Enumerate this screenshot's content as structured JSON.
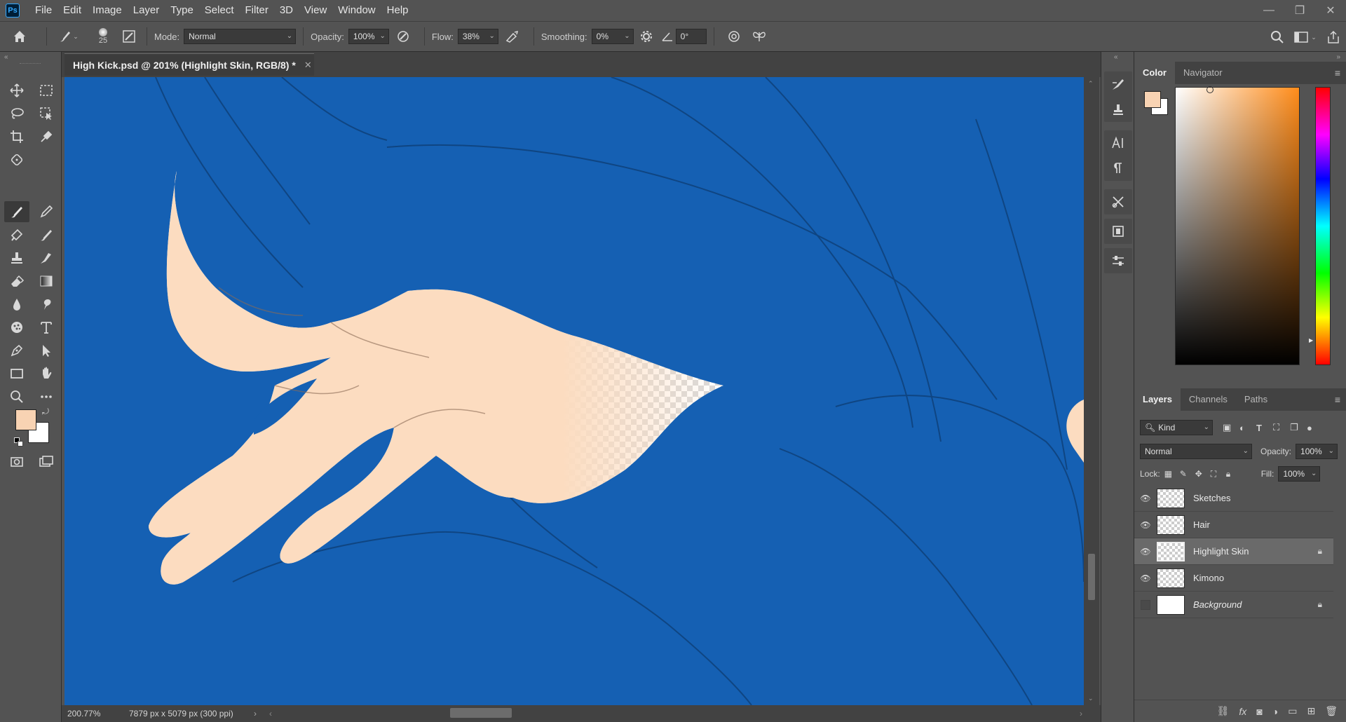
{
  "app": {
    "logo": "Ps"
  },
  "menu": [
    "File",
    "Edit",
    "Image",
    "Layer",
    "Type",
    "Select",
    "Filter",
    "3D",
    "View",
    "Window",
    "Help"
  ],
  "window_controls": {
    "minimize": "—",
    "restore": "❐",
    "close": "✕"
  },
  "options": {
    "brush_size": "25",
    "mode_label": "Mode:",
    "mode_value": "Normal",
    "opacity_label": "Opacity:",
    "opacity_value": "100%",
    "flow_label": "Flow:",
    "flow_value": "38%",
    "smoothing_label": "Smoothing:",
    "smoothing_value": "0%",
    "angle_value": "0°"
  },
  "document": {
    "tab_title": "High Kick.psd @ 201% (Highlight Skin, RGB/8) *",
    "zoom": "200.77%",
    "dimensions": "7879 px x 5079 px (300 ppi)"
  },
  "color_panel": {
    "tabs": [
      "Color",
      "Navigator"
    ],
    "foreground": "#f8d3b3",
    "background": "#ffffff"
  },
  "layers_panel": {
    "tabs": [
      "Layers",
      "Channels",
      "Paths"
    ],
    "filter_kind": "Kind",
    "blend_mode": "Normal",
    "opacity_label": "Opacity:",
    "opacity_value": "100%",
    "lock_label": "Lock:",
    "fill_label": "Fill:",
    "fill_value": "100%",
    "layers": [
      {
        "name": "Sketches",
        "visible": true,
        "locked": false
      },
      {
        "name": "Hair",
        "visible": true,
        "locked": false
      },
      {
        "name": "Highlight Skin",
        "visible": true,
        "locked": true,
        "selected": true
      },
      {
        "name": "Kimono",
        "visible": true,
        "locked": false
      },
      {
        "name": "Background",
        "visible": false,
        "locked": true
      }
    ]
  },
  "colors": {
    "canvas_blue": "#1560b3",
    "skin": "#fcdcc0",
    "ui_bg": "#535353"
  }
}
